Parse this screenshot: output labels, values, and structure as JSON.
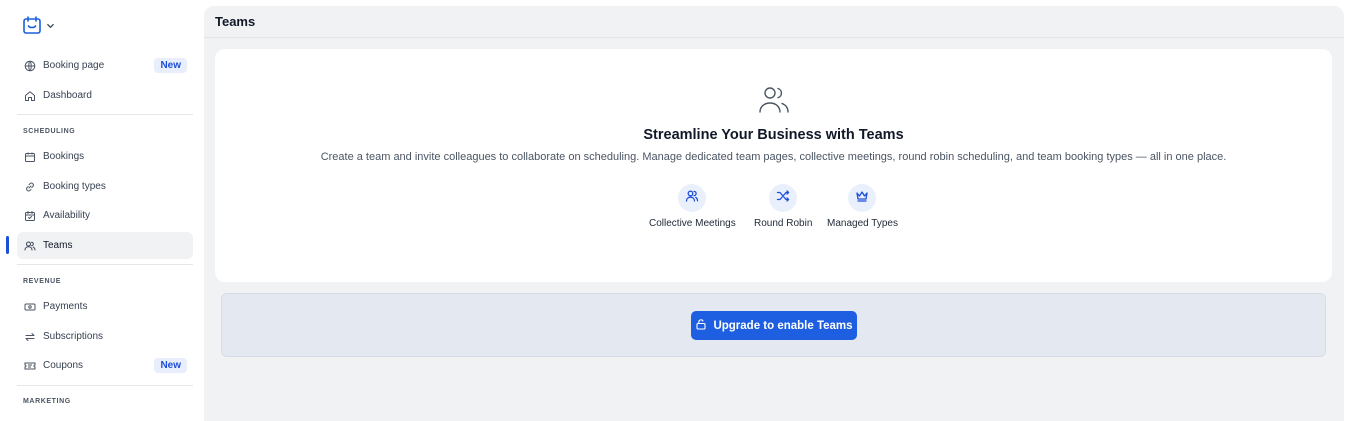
{
  "sidebar": {
    "logo_alt": "calendar-logo",
    "items_top": [
      {
        "label": "Booking page",
        "icon": "globe-icon",
        "badge": "New"
      },
      {
        "label": "Dashboard",
        "icon": "home-icon"
      }
    ],
    "sections": [
      {
        "label": "SCHEDULING",
        "items": [
          {
            "label": "Bookings",
            "icon": "calendar-icon"
          },
          {
            "label": "Booking types",
            "icon": "link-icon"
          },
          {
            "label": "Availability",
            "icon": "calendar-check-icon"
          },
          {
            "label": "Teams",
            "icon": "users-icon",
            "active": true
          }
        ]
      },
      {
        "label": "REVENUE",
        "items": [
          {
            "label": "Payments",
            "icon": "cash-icon"
          },
          {
            "label": "Subscriptions",
            "icon": "repeat-icon"
          },
          {
            "label": "Coupons",
            "icon": "ticket-icon",
            "badge": "New"
          }
        ]
      },
      {
        "label": "MARKETING",
        "items": []
      }
    ]
  },
  "header": {
    "title": "Teams"
  },
  "card": {
    "title": "Streamline Your Business with Teams",
    "description": "Create a team and invite colleagues to collaborate on scheduling. Manage dedicated team pages, collective meetings, round robin scheduling, and team booking types — all in one place.",
    "features": [
      {
        "label": "Collective Meetings",
        "icon": "users-icon"
      },
      {
        "label": "Round Robin",
        "icon": "shuffle-icon"
      },
      {
        "label": "Managed Types",
        "icon": "crown-icon"
      }
    ]
  },
  "upgrade": {
    "button_label": "Upgrade to enable Teams",
    "icon": "lock-icon"
  },
  "colors": {
    "accent": "#1d5fe0",
    "badge_bg": "#e8eefb",
    "main_bg": "#f1f2f4"
  }
}
